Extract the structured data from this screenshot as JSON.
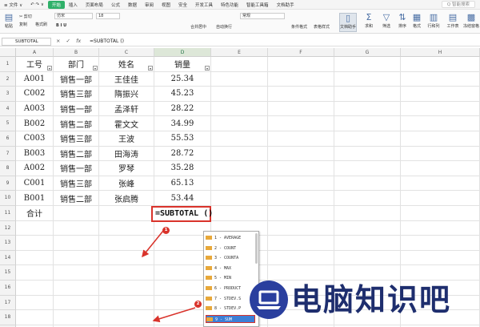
{
  "menu": {
    "items": [
      {
        "label": "≡ 文件 ∨",
        "active": false
      },
      {
        "label": "开始",
        "active": true
      },
      {
        "label": "插入",
        "active": false
      },
      {
        "label": "页面布局",
        "active": false
      },
      {
        "label": "公式",
        "active": false
      },
      {
        "label": "数据",
        "active": false
      },
      {
        "label": "审阅",
        "active": false
      },
      {
        "label": "视图",
        "active": false
      },
      {
        "label": "安全",
        "active": false
      },
      {
        "label": "开发工具",
        "active": false
      },
      {
        "label": "特色功能",
        "active": false
      },
      {
        "label": "智能工具箱",
        "active": false
      },
      {
        "label": "文档助手",
        "active": false
      }
    ],
    "search": "Q 智能搜索"
  },
  "ribbon": {
    "cut": "✂ 剪切",
    "copy": "复制",
    "paste": "粘贴",
    "format_painter": "格式刷",
    "font_name": "仿宋",
    "font_size": "18",
    "bold_italic": "B I U",
    "merge": "合并居中",
    "wrap": "自动换行",
    "number_format": "常规",
    "cond_format": "条件格式",
    "table_style": "表格样式",
    "doc_helper": "文档助手",
    "sum": "求和",
    "filter": "筛选",
    "sort": "排序",
    "format": "格式",
    "row_col": "行和列",
    "sheet": "工作表",
    "freeze": "冻结窗格"
  },
  "formula_bar": {
    "name_box": "SUBTOTAL",
    "formula": "=SUBTOTAL ()",
    "icons": [
      "×",
      "✓",
      "fx"
    ]
  },
  "columns": [
    "A",
    "B",
    "C",
    "D",
    "E",
    "F",
    "G",
    "H"
  ],
  "row_numbers": [
    "1",
    "2",
    "3",
    "4",
    "5",
    "6",
    "7",
    "8",
    "9",
    "10",
    "11",
    "12",
    "13",
    "14",
    "15",
    "16",
    "17",
    "18",
    "19"
  ],
  "table": {
    "headers": [
      "工号",
      "部门",
      "姓名",
      "销量"
    ],
    "rows": [
      [
        "A001",
        "销售一部",
        "王佳佳",
        "25.34"
      ],
      [
        "C002",
        "销售三部",
        "隋振兴",
        "45.23"
      ],
      [
        "A003",
        "销售一部",
        "孟泽轩",
        "28.22"
      ],
      [
        "B002",
        "销售二部",
        "霍文文",
        "34.99"
      ],
      [
        "C003",
        "销售三部",
        "王波",
        "55.53"
      ],
      [
        "B003",
        "销售二部",
        "田海涛",
        "28.72"
      ],
      [
        "A002",
        "销售一部",
        "罗琴",
        "35.28"
      ],
      [
        "C001",
        "销售三部",
        "张峰",
        "65.13"
      ],
      [
        "B001",
        "销售二部",
        "张启腾",
        "53.44"
      ]
    ],
    "total_label": "合计",
    "active_cell_formula": "=SUBTOTAL ()"
  },
  "autocomplete": [
    {
      "label": "1 - AVERAGE",
      "highlighted": false
    },
    {
      "label": "2 - COUNT",
      "highlighted": false
    },
    {
      "label": "3 - COUNTA",
      "highlighted": false
    },
    {
      "label": "4 - MAX",
      "highlighted": false
    },
    {
      "label": "5 - MIN",
      "highlighted": false
    },
    {
      "label": "6 - PRODUCT",
      "highlighted": false
    },
    {
      "label": "7 - STDEV.S",
      "highlighted": false
    },
    {
      "label": "8 - STDEV.P",
      "highlighted": false
    },
    {
      "label": "9 - SUM",
      "highlighted": true
    }
  ],
  "annotations": {
    "step1": "1",
    "step2": "2",
    "color": "#d9332b"
  },
  "watermark": {
    "text": "电脑知识吧"
  },
  "colors": {
    "accent": "#2fb069",
    "highlight": "#d9332b",
    "selection": "#3d7fd6"
  }
}
